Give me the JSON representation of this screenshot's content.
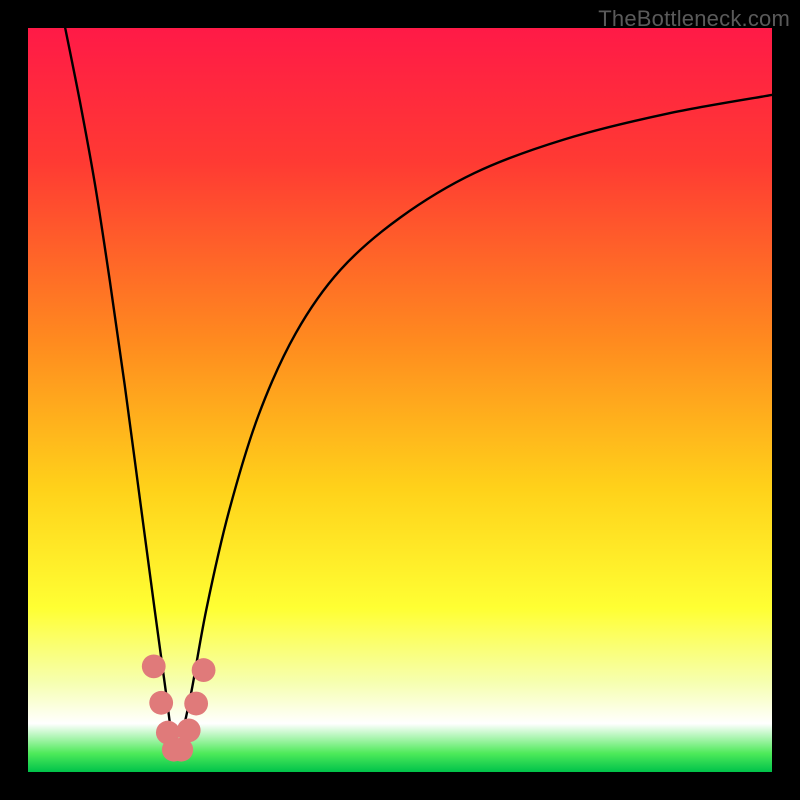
{
  "watermark": "TheBottleneck.com",
  "chart_data": {
    "type": "line",
    "title": "",
    "xlabel": "",
    "ylabel": "",
    "xlim": [
      0,
      100
    ],
    "ylim": [
      0,
      100
    ],
    "gradient_stops": [
      {
        "offset": 0.0,
        "color": "#ff1a47"
      },
      {
        "offset": 0.18,
        "color": "#ff3a33"
      },
      {
        "offset": 0.42,
        "color": "#ff8a1f"
      },
      {
        "offset": 0.62,
        "color": "#ffd21a"
      },
      {
        "offset": 0.78,
        "color": "#ffff33"
      },
      {
        "offset": 0.88,
        "color": "#f6ffb0"
      },
      {
        "offset": 0.935,
        "color": "#ffffff"
      },
      {
        "offset": 0.975,
        "color": "#4eea5a"
      },
      {
        "offset": 1.0,
        "color": "#00c24a"
      }
    ],
    "series": [
      {
        "name": "bottleneck-curve",
        "x_min_at": 20,
        "points": [
          {
            "x": 5.0,
            "y": 100.0
          },
          {
            "x": 7.0,
            "y": 90.0
          },
          {
            "x": 9.0,
            "y": 79.0
          },
          {
            "x": 11.0,
            "y": 66.0
          },
          {
            "x": 13.0,
            "y": 52.0
          },
          {
            "x": 15.0,
            "y": 37.0
          },
          {
            "x": 17.0,
            "y": 22.0
          },
          {
            "x": 18.5,
            "y": 11.0
          },
          {
            "x": 19.3,
            "y": 5.0
          },
          {
            "x": 20.0,
            "y": 2.2
          },
          {
            "x": 20.7,
            "y": 5.0
          },
          {
            "x": 22.0,
            "y": 11.0
          },
          {
            "x": 24.0,
            "y": 22.0
          },
          {
            "x": 27.0,
            "y": 35.0
          },
          {
            "x": 31.0,
            "y": 48.0
          },
          {
            "x": 36.0,
            "y": 59.0
          },
          {
            "x": 42.0,
            "y": 67.5
          },
          {
            "x": 50.0,
            "y": 74.5
          },
          {
            "x": 60.0,
            "y": 80.5
          },
          {
            "x": 72.0,
            "y": 85.0
          },
          {
            "x": 86.0,
            "y": 88.5
          },
          {
            "x": 100.0,
            "y": 91.0
          }
        ]
      }
    ],
    "markers": {
      "name": "dip-markers",
      "color": "#e07a7a",
      "radius_pct": 1.6,
      "points": [
        {
          "x": 16.9,
          "y": 14.2
        },
        {
          "x": 17.9,
          "y": 9.3
        },
        {
          "x": 18.8,
          "y": 5.3
        },
        {
          "x": 19.6,
          "y": 3.0
        },
        {
          "x": 20.6,
          "y": 3.0
        },
        {
          "x": 21.6,
          "y": 5.6
        },
        {
          "x": 22.6,
          "y": 9.2
        },
        {
          "x": 23.6,
          "y": 13.7
        }
      ]
    }
  }
}
